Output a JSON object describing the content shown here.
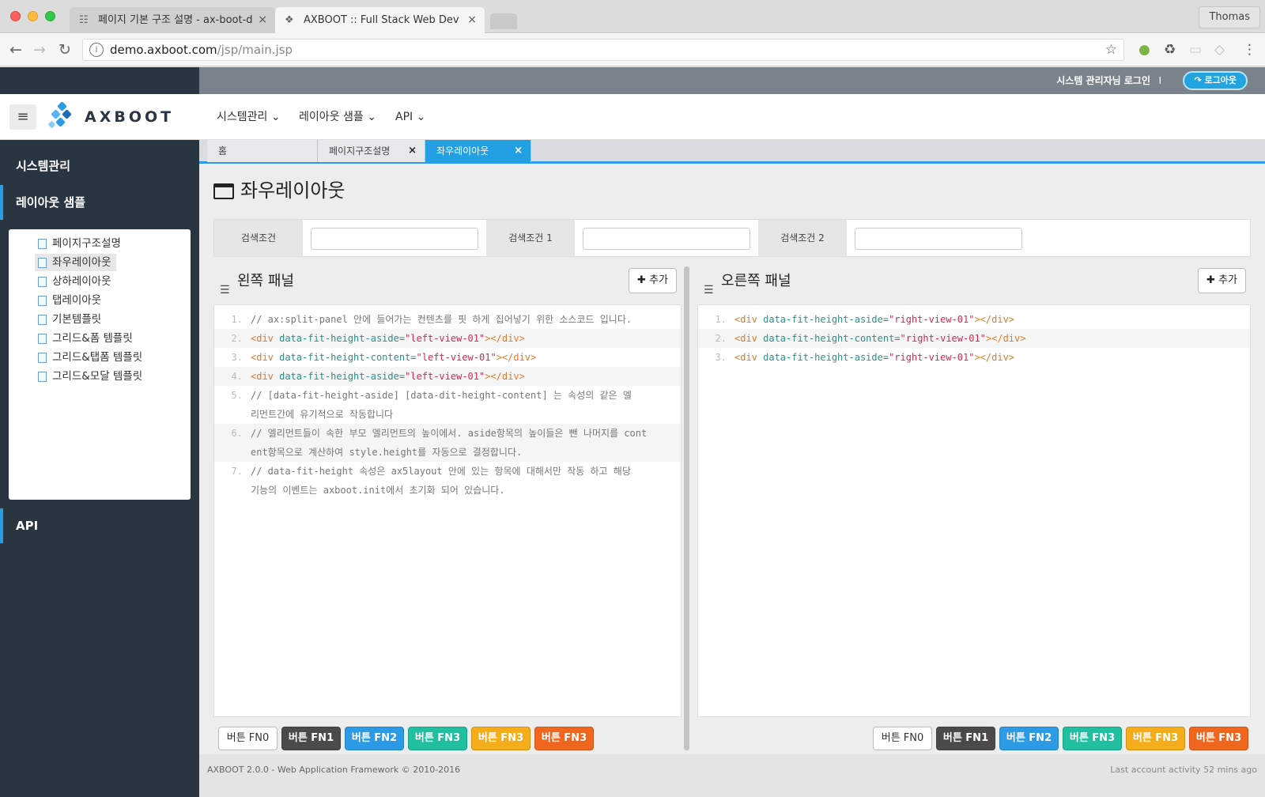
{
  "browser": {
    "tabs": [
      {
        "title": "페이지 기본 구조 설명 - ax-boot-d"
      },
      {
        "title": "AXBOOT :: Full Stack Web Dev"
      }
    ],
    "profile": "Thomas",
    "url_host": "demo.axboot.com",
    "url_path": "/jsp/main.jsp"
  },
  "app": {
    "user_info": "시스템 관리자님 로그인",
    "separator": "I",
    "logout_label": "로그아웃",
    "logo_text": "AXBOOT",
    "menus": [
      "시스템관리",
      "레이아웃 샘플",
      "API"
    ]
  },
  "sidebar": {
    "groups": [
      "시스템관리",
      "레이아웃 샘플",
      "API"
    ],
    "tree": [
      "페이지구조설명",
      "좌우레이아웃",
      "상하레이아웃",
      "탭레이아웃",
      "기본템플릿",
      "그리드&폼 템플릿",
      "그리드&탭폼 템플릿",
      "그리드&모달 템플릿"
    ],
    "selected": "좌우레이아웃"
  },
  "content": {
    "tabs": [
      "홈",
      "페이지구조설명",
      "좌우레이아웃"
    ],
    "active_tab": "좌우레이아웃",
    "page_title": "좌우레이아웃",
    "search": [
      "검색조건",
      "검색조건 1",
      "검색조건 2"
    ],
    "left_panel": {
      "title": "왼쪽 패널",
      "add_label": "추가",
      "lines": [
        {
          "n": "1.",
          "text": "// ax:split-panel 안에 들어가는 컨텐츠를 핏 하게 집어넣기 위한 소스코드 입니다."
        },
        {
          "n": "2.",
          "tag1": "<div",
          "attr": " data-fit-height-aside=",
          "str": "\"left-view-01\"",
          "tag2": "></div>"
        },
        {
          "n": "3.",
          "tag1": "<div",
          "attr": " data-fit-height-content=",
          "str": "\"left-view-01\"",
          "tag2": "></div>"
        },
        {
          "n": "4.",
          "tag1": "<div",
          "attr": " data-fit-height-aside=",
          "str": "\"left-view-01\"",
          "tag2": "></div>"
        },
        {
          "n": "5.",
          "text": "// [data-fit-height-aside] [data-dit-height-content] 는 속성의 같은 엘",
          "text2": "리먼트간에 유기적으로 작동합니다"
        },
        {
          "n": "6.",
          "text": "// 엘리먼트들이 속한 부모 엘리먼트의 높이에서. aside항목의 높이들은 뺀 나머지를 cont",
          "text2": "ent항목으로 계산하여 style.height를 자동으로 결정합니다."
        },
        {
          "n": "7.",
          "text": "// data-fit-height 속성은 ax5layout 안에 있는 항목에 대해서만 작동 하고 해당",
          "text2": " 기능의 이벤트는 axboot.init에서 초기화 되어 있습니다."
        }
      ]
    },
    "right_panel": {
      "title": "오른쪽 패널",
      "add_label": "추가",
      "lines": [
        {
          "n": "1.",
          "tag1": "<div",
          "attr": " data-fit-height-aside=",
          "str": "\"right-view-01\"",
          "tag2": "></div>"
        },
        {
          "n": "2.",
          "tag1": "<div",
          "attr": " data-fit-height-content=",
          "str": "\"right-view-01\"",
          "tag2": "></div>"
        },
        {
          "n": "3.",
          "tag1": "<div",
          "attr": " data-fit-height-aside=",
          "str": "\"right-view-01\"",
          "tag2": "></div>"
        }
      ]
    },
    "buttons": [
      {
        "label": "버튼 FN0",
        "color": "#ffffff"
      },
      {
        "label": "버튼 FN1",
        "color": "#4a4a4a"
      },
      {
        "label": "버튼 FN2",
        "color": "#2d9ae6"
      },
      {
        "label": "버튼 FN3",
        "color": "#1fbf9f"
      },
      {
        "label": "버튼 FN3",
        "color": "#f6ad1b"
      },
      {
        "label": "버튼 FN3",
        "color": "#f0661f"
      }
    ],
    "footer_left": "AXBOOT 2.0.0 - Web Application Framework © 2010-2016",
    "footer_right": "Last account activity 52 mins ago"
  },
  "colors": {
    "accent": "#2d9ae6",
    "sidebar": "#2a3542",
    "topbar": "#7a828c"
  }
}
